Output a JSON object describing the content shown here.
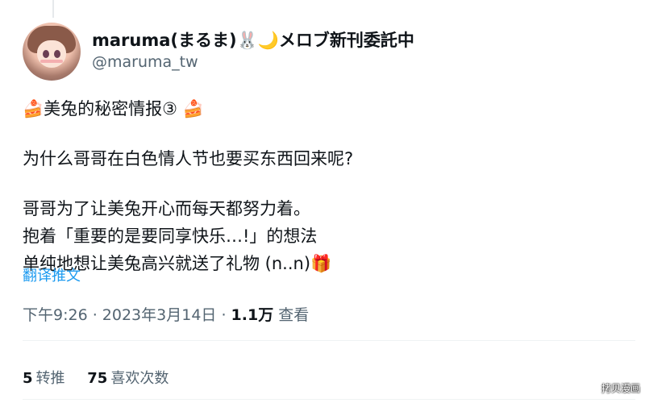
{
  "user": {
    "display_name": "maruma(まるま)🐰🌙メロブ新刊委託中",
    "handle": "@maruma_tw"
  },
  "tweet": {
    "lines": [
      "🍰美兔的秘密情报③ 🍰",
      "",
      "为什么哥哥在白色情人节也要买东西回来呢?",
      "",
      "哥哥为了让美兔开心而每天都努力着。",
      "抱着「重要的是要同享快乐…!」的想法",
      "单纯地想让美兔高兴就送了礼物 (n..n)🎁"
    ],
    "translate_label": "翻译推文"
  },
  "meta": {
    "timestamp": "下午9:26 · 2023年3月14日 · ",
    "views_count": "1.1万",
    "views_label": " 查看"
  },
  "stats": {
    "retweets_count": "5",
    "retweets_label": "转推",
    "likes_count": "75",
    "likes_label": "喜欢次数"
  },
  "watermark": "拷贝漫画",
  "colors": {
    "accent": "#1d9bf0",
    "text_primary": "#0f1419",
    "text_secondary": "#536471",
    "divider": "#eff3f4"
  }
}
